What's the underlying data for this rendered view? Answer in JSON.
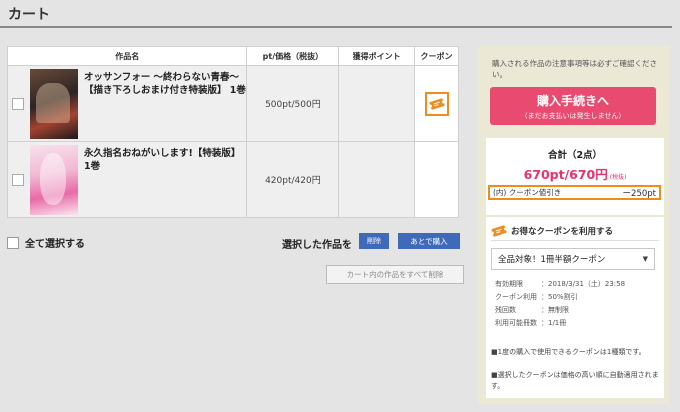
{
  "page": {
    "title": "カート"
  },
  "table": {
    "headers": {
      "item": "作品名",
      "price": "pt/価格（税抜）",
      "points": "獲得ポイント",
      "coupon": "クーポン"
    },
    "rows": [
      {
        "title": "オッサンフォー 〜終わらない青春〜【描き下ろしおまけ付き特装版】 1巻",
        "price": "500pt/500円",
        "points": ""
      },
      {
        "title": "永久指名おねがいします!【特装版】 1巻",
        "price": "420pt/420円",
        "points": ""
      }
    ]
  },
  "actions": {
    "select_all": "全て選択する",
    "selected_label": "選択した作品を",
    "delete": "削除",
    "later": "あとで購入",
    "clear_all": "カート内の作品をすべて削除"
  },
  "panel": {
    "notice": "購入される作品の注意事項等は必ずご確認ください。",
    "checkout": "購入手続きへ",
    "checkout_sub": "（まだお支払いは発生しません）",
    "total_label": "合計（2点）",
    "total_price": "670pt/670円",
    "tax_note": "(税抜)",
    "discount_label": "(内) クーポン値引き",
    "discount_amount": "ー250pt"
  },
  "coupon": {
    "heading": "お得なクーポンを利用する",
    "selected": "全品対象！1冊半額クーポン",
    "details": [
      {
        "key": "有効期限",
        "value": "：2018/3/31（土）23:58"
      },
      {
        "key": "クーポン利用",
        "value": "：50%割引"
      },
      {
        "key": "残回数",
        "value": "：無制限"
      },
      {
        "key": "利用可能冊数",
        "value": "：1/1冊"
      }
    ],
    "note1": "■1度の購入で使用できるクーポンは1種類です。",
    "note2": "■選択したクーポンは価格の高い順に自動適用されます。"
  },
  "colors": {
    "accent_pink": "#e8336d",
    "button_blue": "#3f6ab9",
    "coupon_orange": "#f08c1e",
    "checkout": "#e84b6f"
  }
}
